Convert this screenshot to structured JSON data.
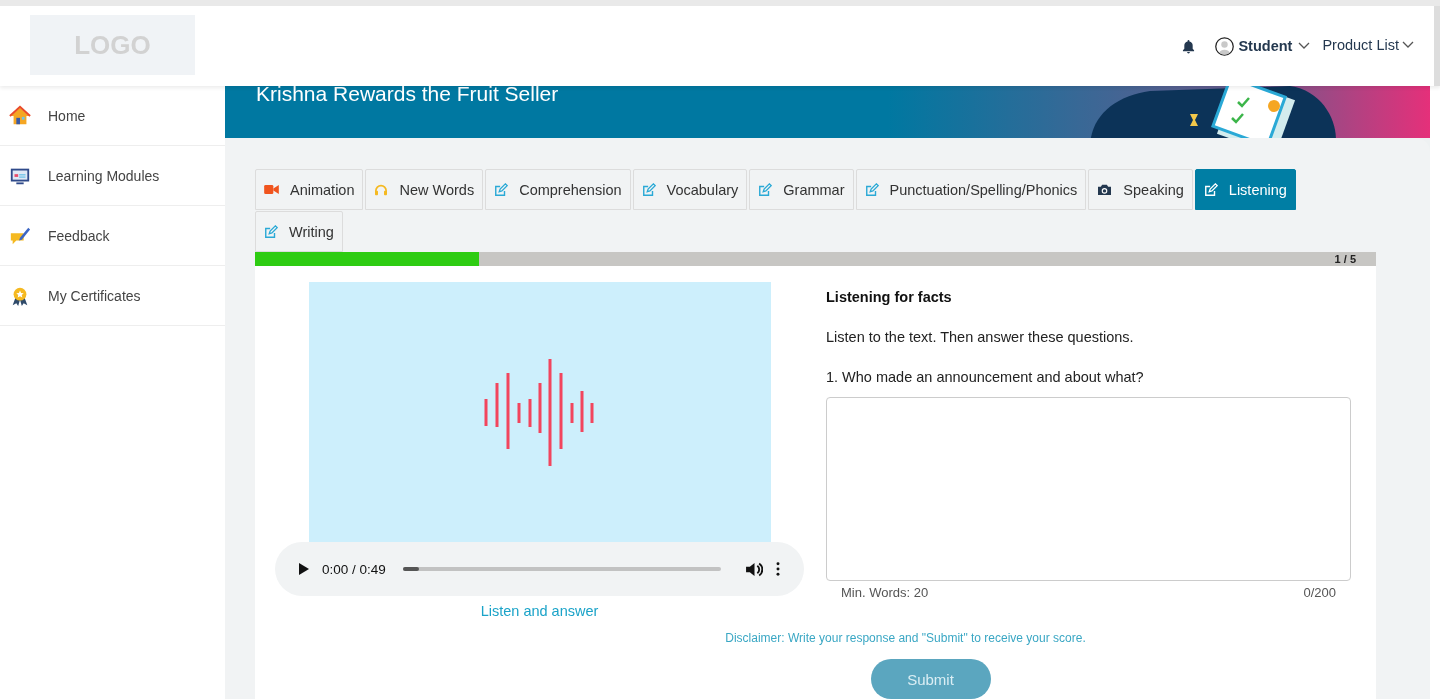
{
  "header": {
    "logo": "LOGO",
    "user": "Student",
    "product_menu": "Product List"
  },
  "sidebar": {
    "items": [
      {
        "label": "Home",
        "kind": "house",
        "selected": false
      },
      {
        "label": "Learning Modules",
        "kind": "monitor",
        "selected": false
      },
      {
        "label": "Feedback",
        "kind": "feedback",
        "selected": false
      },
      {
        "label": "My Certificates",
        "kind": "medal",
        "selected": false
      }
    ]
  },
  "banner": {
    "title": "Krishna Rewards the Fruit Seller"
  },
  "tabs": [
    {
      "label": "Animation",
      "kind": "video",
      "selected": false
    },
    {
      "label": "New Words",
      "kind": "headphones",
      "selected": false
    },
    {
      "label": "Comprehension",
      "kind": "edit",
      "selected": false
    },
    {
      "label": "Vocabulary",
      "kind": "edit",
      "selected": false
    },
    {
      "label": "Grammar",
      "kind": "edit",
      "selected": false
    },
    {
      "label": "Punctuation/Spelling/Phonics",
      "kind": "edit",
      "selected": false
    },
    {
      "label": "Speaking",
      "kind": "camera",
      "selected": false
    },
    {
      "label": "Listening",
      "kind": "edit",
      "selected": true
    },
    {
      "label": "Writing",
      "kind": "edit",
      "selected": false
    }
  ],
  "progress": {
    "level": 0.2,
    "label": "1 / 5"
  },
  "audio": {
    "time": "0:00 / 0:49",
    "level": 0.05,
    "caption": "Listen and answer"
  },
  "question": {
    "heading": "Listening for facts",
    "instruction": "Listen to the text. Then answer these questions.",
    "prompt": "1. Who made an announcement and about what?",
    "min_words": "Min. Words: 20",
    "count": "0/200"
  },
  "disclaimer": "Disclaimer: Write your response and \"Submit\" to receive your score.",
  "submit": "Submit"
}
